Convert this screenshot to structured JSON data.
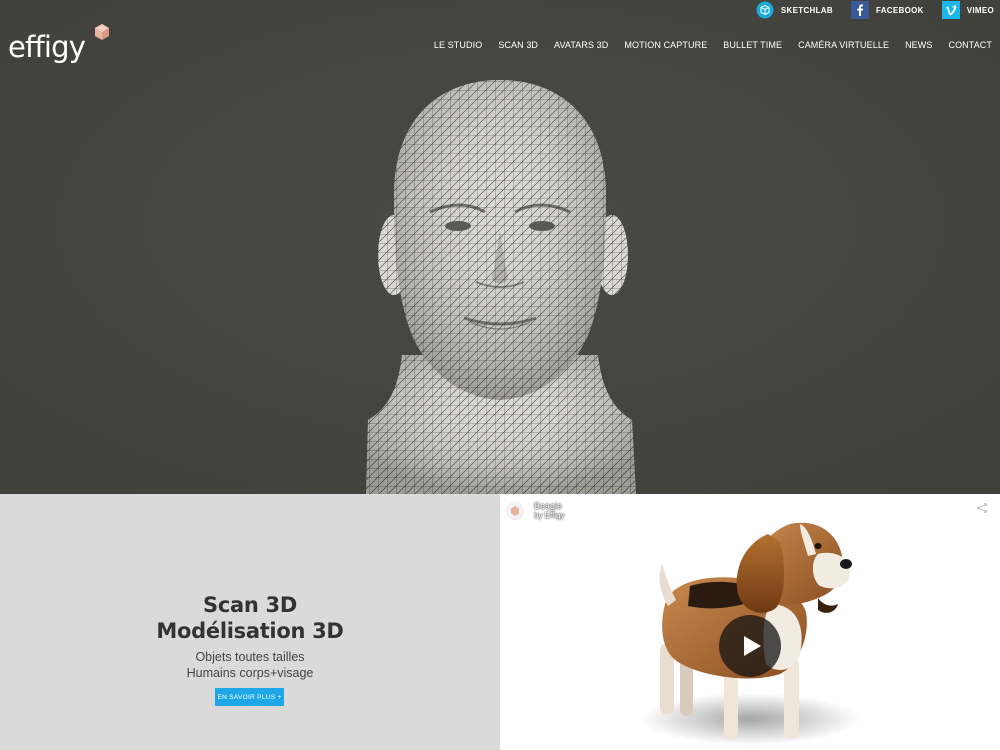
{
  "header": {
    "logo_text": "effigy",
    "social": [
      {
        "icon": "sketchfab-icon",
        "label": "SKETCHLAB"
      },
      {
        "icon": "facebook-icon",
        "label": "FACEBOOK"
      },
      {
        "icon": "vimeo-icon",
        "label": "VIMEO"
      }
    ],
    "nav": [
      "LE STUDIO",
      "SCAN 3D",
      "AVATARS 3D",
      "MOTION CAPTURE",
      "BULLET TIME",
      "CAMÉRA VIRTUELLE",
      "NEWS",
      "CONTACT"
    ]
  },
  "promo": {
    "title_line1": "Scan 3D",
    "title_line2": "Modélisation 3D",
    "subtitle_line1": "Objets toutes tailles",
    "subtitle_line2": "Humains corps+visage",
    "button_label": "EN SAVOIR PLUS +"
  },
  "viewer": {
    "model_title": "Beagle",
    "model_author": "by Effigy",
    "play_icon": "play-icon",
    "share_icon": "share-icon"
  },
  "colors": {
    "hero_bg": "#454540",
    "promo_bg": "#dadada",
    "accent_blue": "#1ea7e6",
    "facebook_blue": "#3b5998",
    "vimeo_blue": "#1ab7ea",
    "logo_gem": "#e9b4a0"
  }
}
